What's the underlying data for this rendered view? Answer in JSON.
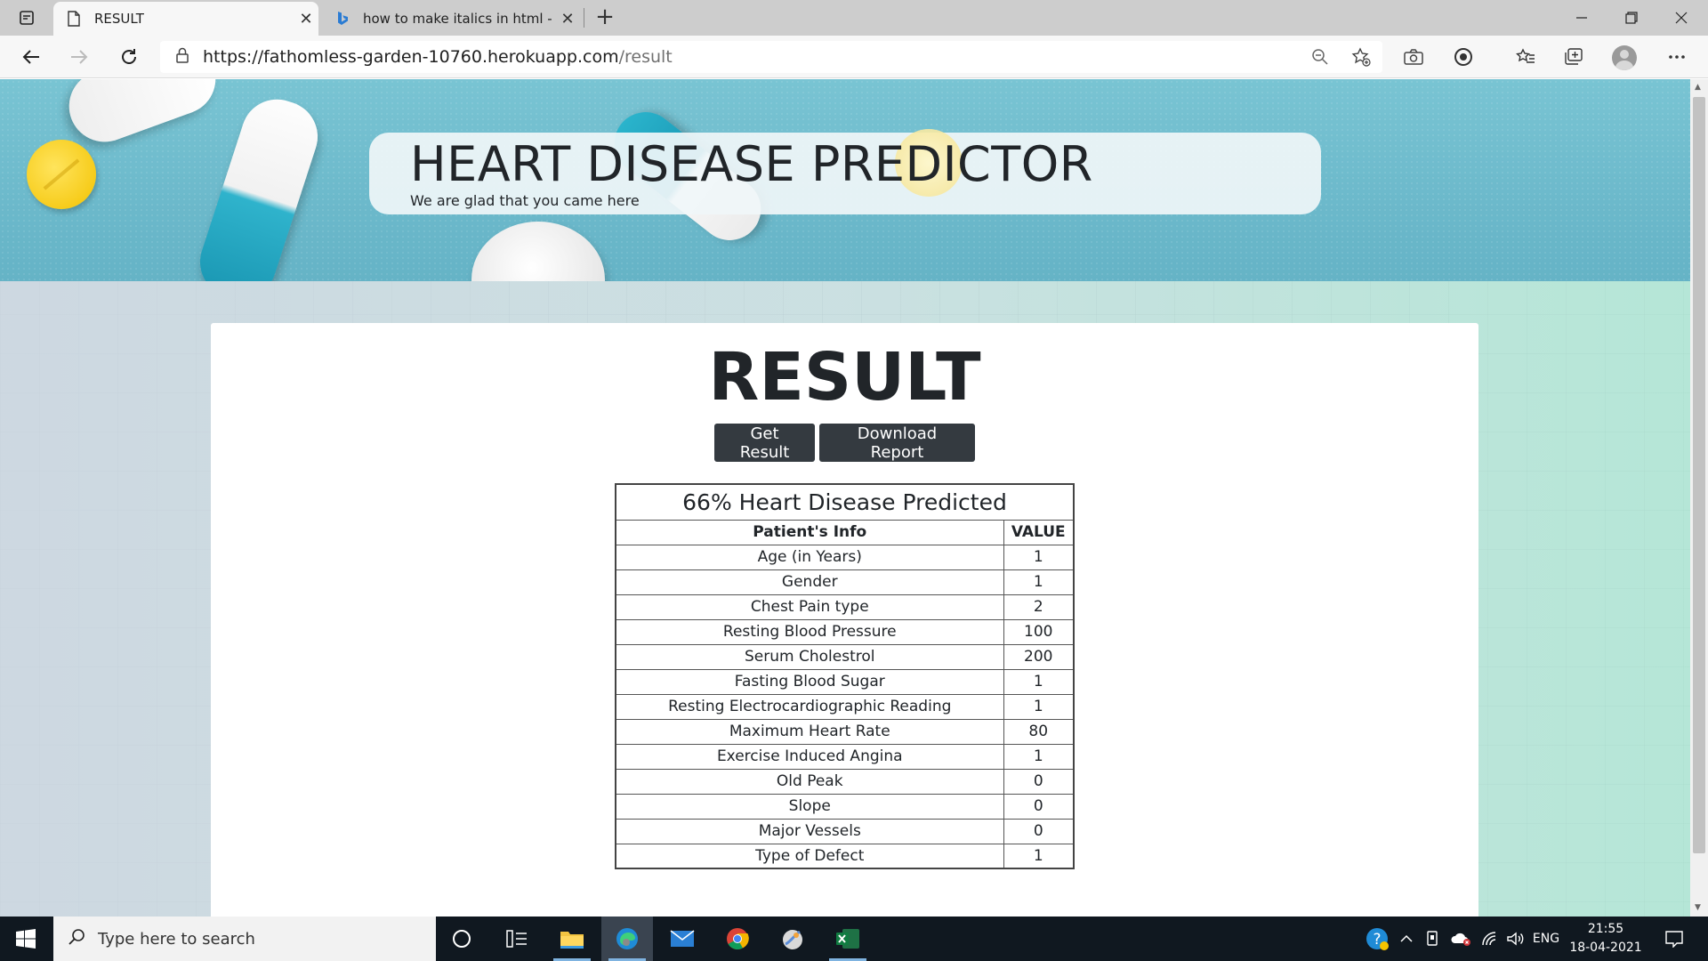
{
  "browser": {
    "tabs": [
      {
        "title": "RESULT",
        "active": true
      },
      {
        "title": "how to make italics in html - Bing",
        "active": false
      }
    ],
    "url_host": "https://fathomless-garden-10760.herokuapp.com",
    "url_path": "/result"
  },
  "hero": {
    "title": "HEART DISEASE PREDICTOR",
    "subtitle": "We are glad that you came here"
  },
  "main": {
    "heading": "RESULT",
    "get_result_label": "Get Result",
    "download_label": "Download Report",
    "prediction": "66% Heart Disease Predicted",
    "columns": [
      "Patient's Info",
      "VALUE"
    ],
    "rows": [
      {
        "label": "Age (in Years)",
        "value": "1"
      },
      {
        "label": "Gender",
        "value": "1"
      },
      {
        "label": "Chest Pain type",
        "value": "2"
      },
      {
        "label": "Resting Blood Pressure",
        "value": "100"
      },
      {
        "label": "Serum Cholestrol",
        "value": "200"
      },
      {
        "label": "Fasting Blood Sugar",
        "value": "1"
      },
      {
        "label": "Resting Electrocardiographic Reading",
        "value": "1"
      },
      {
        "label": "Maximum Heart Rate",
        "value": "80"
      },
      {
        "label": "Exercise Induced Angina",
        "value": "1"
      },
      {
        "label": "Old Peak",
        "value": "0"
      },
      {
        "label": "Slope",
        "value": "0"
      },
      {
        "label": "Major Vessels",
        "value": "0"
      },
      {
        "label": "Type of Defect",
        "value": "1"
      }
    ]
  },
  "taskbar": {
    "search_placeholder": "Type here to search",
    "language": "ENG",
    "time": "21:55",
    "date": "18-04-2021"
  }
}
